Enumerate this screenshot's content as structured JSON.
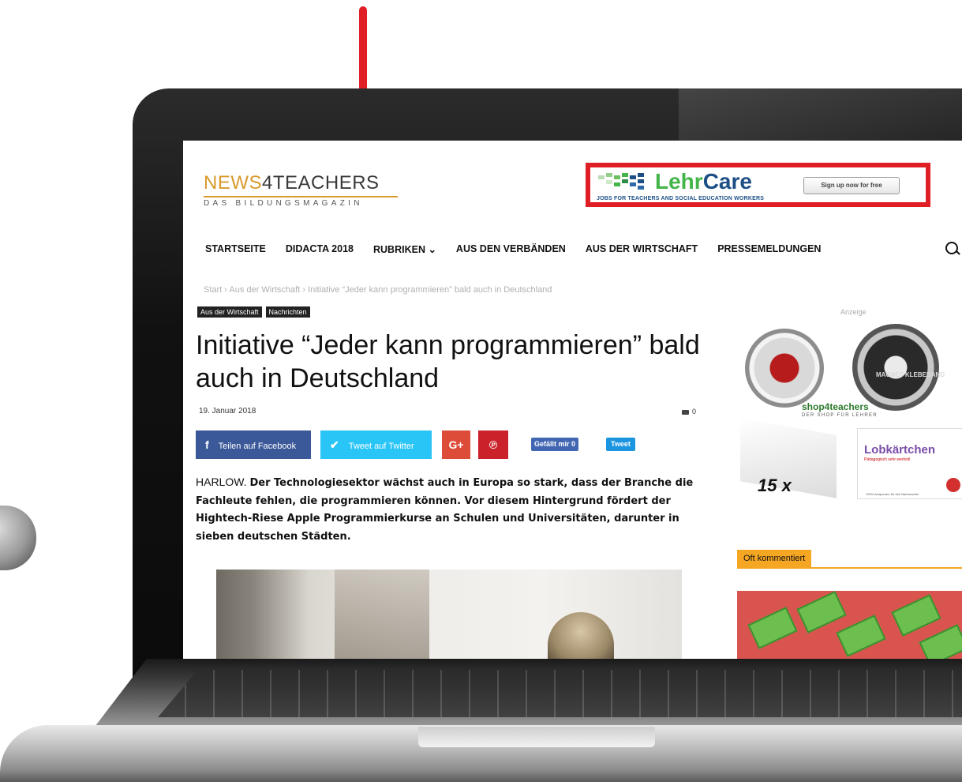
{
  "site": {
    "logo_news": "NEWS",
    "logo_rest": "4TEACHERS",
    "logo_sub": "DAS BILDUNGSMAGAZIN"
  },
  "banner": {
    "brand_a": "Lehr",
    "brand_b": "Care",
    "tagline": "JOBS FOR TEACHERS AND SOCIAL EDUCATION WORKERS",
    "button": "Sign up now for free",
    "accent": "#43b549",
    "brand_color": "#1d4f86"
  },
  "highlight_color": "#e01e26",
  "nav": {
    "items": [
      {
        "label": "STARTSEITE"
      },
      {
        "label": "DIDACTA 2018"
      },
      {
        "label": "RUBRIKEN ⌄"
      },
      {
        "label": "AUS DEN VERBÄNDEN"
      },
      {
        "label": "AUS DER WIRTSCHAFT"
      },
      {
        "label": "PRESSEMELDUNGEN"
      }
    ],
    "search_icon": "search-icon"
  },
  "article": {
    "breadcrumb": "Start  ›  Aus der Wirtschaft  ›  Initiative “Jeder kann programmieren” bald auch in Deutschland",
    "tags": [
      "Aus der Wirtschaft",
      "Nachrichten"
    ],
    "title": "Initiative “Jeder kann programmieren” bald auch in Deutschland",
    "date": "19. Januar 2018",
    "comments": "0",
    "lead_place": "HARLOW.",
    "lead_text": "Der Technologiesektor wächst auch in Europa so stark, dass der Branche die Fachleute fehlen, die programmieren können. Vor diesem Hintergrund fördert der Hightech-Riese Apple Programmierkurse an Schulen und Universitäten, darunter in sieben deutschen Städten."
  },
  "share": {
    "facebook_icon": "f",
    "facebook": "Teilen auf Facebook",
    "twitter": "Tweet auf Twitter",
    "gplus": "G+",
    "pinterest": "℗",
    "like": "Gefällt mir 0",
    "tweet": "Tweet",
    "colors": {
      "facebook": "#3b5999",
      "twitter": "#29c5f6",
      "gplus": "#dd4b39",
      "pinterest": "#ca212a"
    }
  },
  "sidebar": {
    "ad_label": "Anzeige",
    "tape_text": "MAGNET KLEBEBAND",
    "shop_logo": "shop4teachers",
    "shop_sub": "DER SHOP FÜR LEHRER",
    "box_count": "15 x",
    "card_title": "Lobkärtchen",
    "card_sub": "Pädagogisch sehr wertvoll",
    "card_foot": "100% Anspornen für den Nachwuchs!",
    "section_tab": "Oft kommentiert",
    "section_color": "#f5a623"
  }
}
